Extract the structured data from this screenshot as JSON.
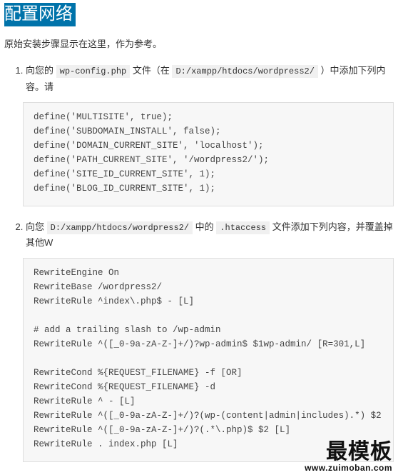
{
  "heading": "配置网络",
  "intro": "原始安装步骤显示在这里，作为参考。",
  "step1": {
    "prefix": "向您的 ",
    "file": "wp-config.php",
    "mid": " 文件（在 ",
    "path": "D:/xampp/htdocs/wordpress2/",
    "suffix": " ）中添加下列内容。请",
    "code": "define('MULTISITE', true);\ndefine('SUBDOMAIN_INSTALL', false);\ndefine('DOMAIN_CURRENT_SITE', 'localhost');\ndefine('PATH_CURRENT_SITE', '/wordpress2/');\ndefine('SITE_ID_CURRENT_SITE', 1);\ndefine('BLOG_ID_CURRENT_SITE', 1);"
  },
  "step2": {
    "prefix": "向您 ",
    "path": "D:/xampp/htdocs/wordpress2/",
    "mid": " 中的 ",
    "file": ".htaccess",
    "suffix": " 文件添加下列内容，并覆盖掉其他W",
    "code": "RewriteEngine On\nRewriteBase /wordpress2/\nRewriteRule ^index\\.php$ - [L]\n\n# add a trailing slash to /wp-admin\nRewriteRule ^([_0-9a-zA-Z-]+/)?wp-admin$ $1wp-admin/ [R=301,L]\n\nRewriteCond %{REQUEST_FILENAME} -f [OR]\nRewriteCond %{REQUEST_FILENAME} -d\nRewriteRule ^ - [L]\nRewriteRule ^([_0-9a-zA-Z-]+/)?(wp-(content|admin|includes).*) $2\nRewriteRule ^([_0-9a-zA-Z-]+/)?(.*\\.php)$ $2 [L]\nRewriteRule . index.php [L]"
  },
  "watermark": {
    "cn": "最模板",
    "en": "www.zuimoban.com"
  }
}
